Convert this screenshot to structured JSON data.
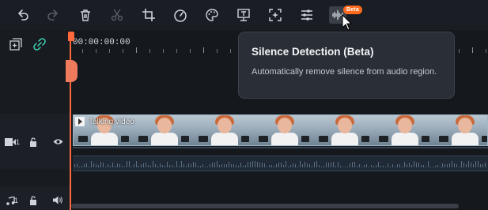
{
  "toolbar": {
    "buttons": [
      {
        "name": "undo-icon",
        "enabled": true
      },
      {
        "name": "redo-icon",
        "enabled": false
      },
      {
        "name": "trash-icon",
        "enabled": true
      },
      {
        "name": "scissors-icon",
        "enabled": false
      },
      {
        "name": "crop-icon",
        "enabled": true
      },
      {
        "name": "speed-icon",
        "enabled": true
      },
      {
        "name": "color-palette-icon",
        "enabled": true
      },
      {
        "name": "text-to-speech-icon",
        "enabled": true
      },
      {
        "name": "auto-reframe-icon",
        "enabled": true
      },
      {
        "name": "adjust-sliders-icon",
        "enabled": true
      },
      {
        "name": "silence-detection-icon",
        "enabled": true
      }
    ],
    "beta_badge": "Beta"
  },
  "timeline": {
    "timecode": "00:00:00:00"
  },
  "tracks": {
    "video": {
      "number": "1",
      "clip_label": "Talking video"
    },
    "audio": {
      "number": "1"
    }
  },
  "tooltip": {
    "title": "Silence Detection (Beta)",
    "description": "Automatically remove silence from audio region."
  },
  "colors": {
    "accent": "#ff6a3d",
    "beta": "#ff6a1e",
    "clip_border": "#9fb7c9"
  }
}
